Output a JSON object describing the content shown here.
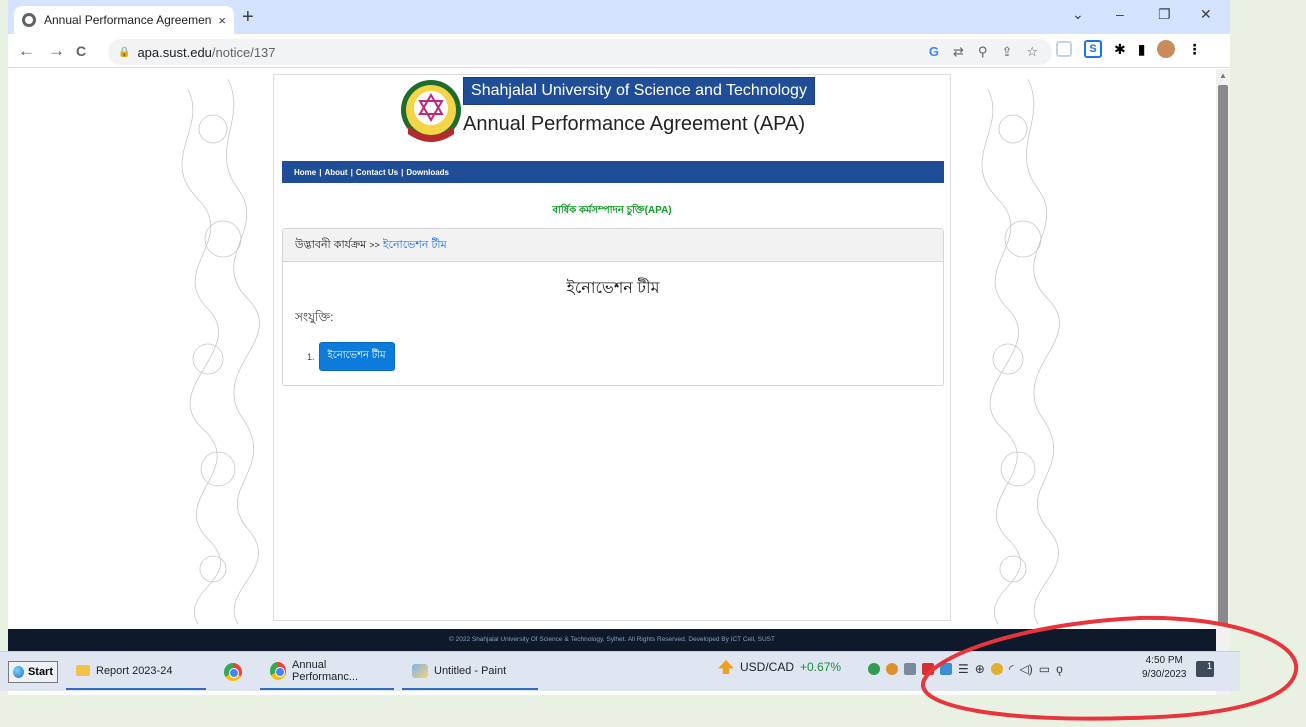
{
  "browser": {
    "tab_title": "Annual Performance Agreement",
    "tab_close": "×",
    "new_tab": "+",
    "url_host": "apa.sust.edu",
    "url_path": "/notice/137",
    "controls": {
      "chevron": "⌄",
      "minimize": "–",
      "restore": "❐",
      "close": "✕"
    },
    "nav": {
      "back": "←",
      "forward": "→",
      "reload": "C",
      "lock": "🔒"
    },
    "omnibox_icons": {
      "google": "G",
      "translate": "⇄",
      "zoom": "⚲",
      "share": "⇪",
      "star": "☆"
    },
    "ext_icons": {
      "s": "S",
      "puzzle": "✱",
      "sidepanel": "▮",
      "menu": "⋮"
    }
  },
  "page": {
    "university_name": "Shahjalal University of Science and Technology",
    "apa_title": "Annual Performance Agreement (APA)",
    "nav_items": [
      "Home",
      "About",
      "Contact Us",
      "Downloads"
    ],
    "nav_sep": "|",
    "bangla_heading": "বার্ষিক কর্মসম্পাদন চুক্তি(APA)",
    "breadcrumb_parent": "উদ্ভাবনী কার্যক্রম",
    "breadcrumb_sep": ">>",
    "breadcrumb_current": "ইনোভেশন টীম",
    "notice_title": "ইনোভেশন টীম",
    "attachments_label": "সংযুক্তি:",
    "attachment_index": "1.",
    "attachment_button": "ইনোভেশন টীম",
    "footer": "© 2022 Shahjalal University Of Science & Technology, Sylhet. All Rights Reserved. Developed By ICT Cell, SUST"
  },
  "taskbar": {
    "start": "Start",
    "tasks": [
      "Report 2023-24",
      "Annual Performanc...",
      "Untitled - Paint"
    ],
    "ticker_symbol": "USD/CAD",
    "ticker_change": "+0.67%",
    "time": "4:50 PM",
    "date": "9/30/2023",
    "notif_count": "1"
  },
  "colors": {
    "banner": "#1f4e96",
    "heading_green": "#119b27",
    "link_blue": "#1a73e8",
    "annotation_red": "#e8343a"
  }
}
